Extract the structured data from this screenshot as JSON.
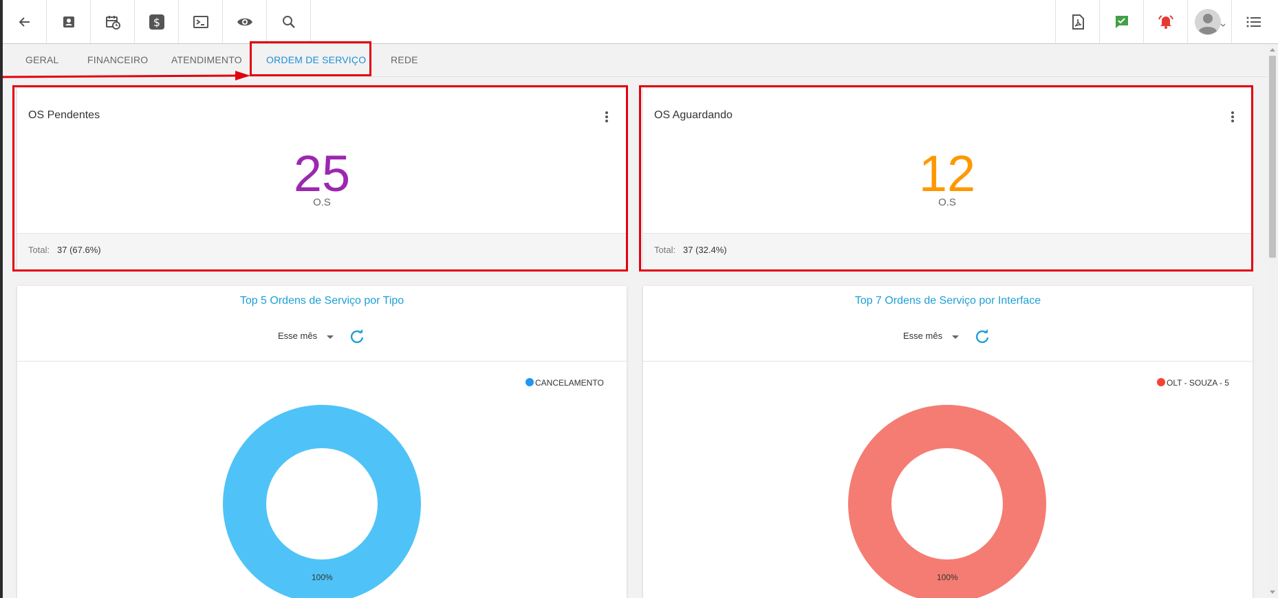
{
  "icons": {
    "back": "arrow-left-icon",
    "contact": "contact-card-icon",
    "calendar": "calendar-clock-icon",
    "finance": "dollar-icon",
    "terminal": "terminal-icon",
    "view": "eye-icon",
    "search": "search-icon",
    "pdf": "pdf-icon",
    "chat": "chat-check-icon",
    "alarm": "alarm-bell-icon",
    "avatar": "avatar-icon",
    "menu": "list-menu-icon"
  },
  "tabs": [
    {
      "label": "GERAL"
    },
    {
      "label": "FINANCEIRO"
    },
    {
      "label": "ATENDIMENTO"
    },
    {
      "label": "ORDEM DE SERVIÇO"
    },
    {
      "label": "REDE"
    }
  ],
  "active_tab": "ORDEM DE SERVIÇO",
  "cards": [
    {
      "title": "OS Pendentes",
      "value": "25",
      "unit": "O.S",
      "total_label": "Total:",
      "total_value": "37 (67.6%)",
      "color": "#9c27b0"
    },
    {
      "title": "OS Aguardando",
      "value": "12",
      "unit": "O.S",
      "total_label": "Total:",
      "total_value": "37 (32.4%)",
      "color": "#ff9800"
    }
  ],
  "charts_panels": [
    {
      "title": "Top 5 Ordens de Serviço por Tipo",
      "filter": "Esse mês"
    },
    {
      "title": "Top 7 Ordens de Serviço por Interface",
      "filter": "Esse mês"
    }
  ],
  "chart_data": [
    {
      "type": "pie",
      "title": "Top 5 Ordens de Serviço por Tipo",
      "categories": [
        "CANCELAMENTO"
      ],
      "values": [
        100
      ],
      "slice_labels": [
        "100%"
      ],
      "colors": [
        "#4fc3f7"
      ],
      "legend_colors": [
        "#2196f3"
      ],
      "legend": "top-right"
    },
    {
      "type": "pie",
      "title": "Top 7 Ordens de Serviço por Interface",
      "categories": [
        "OLT - SOUZA - 5"
      ],
      "values": [
        100
      ],
      "slice_labels": [
        "100%"
      ],
      "colors": [
        "#f47c73"
      ],
      "legend_colors": [
        "#f44336"
      ],
      "legend": "top-right"
    }
  ],
  "colors": {
    "accent": "#1d8fd8",
    "highlight": "#e3000f",
    "chat": "#43a047",
    "alarm": "#e53935"
  }
}
